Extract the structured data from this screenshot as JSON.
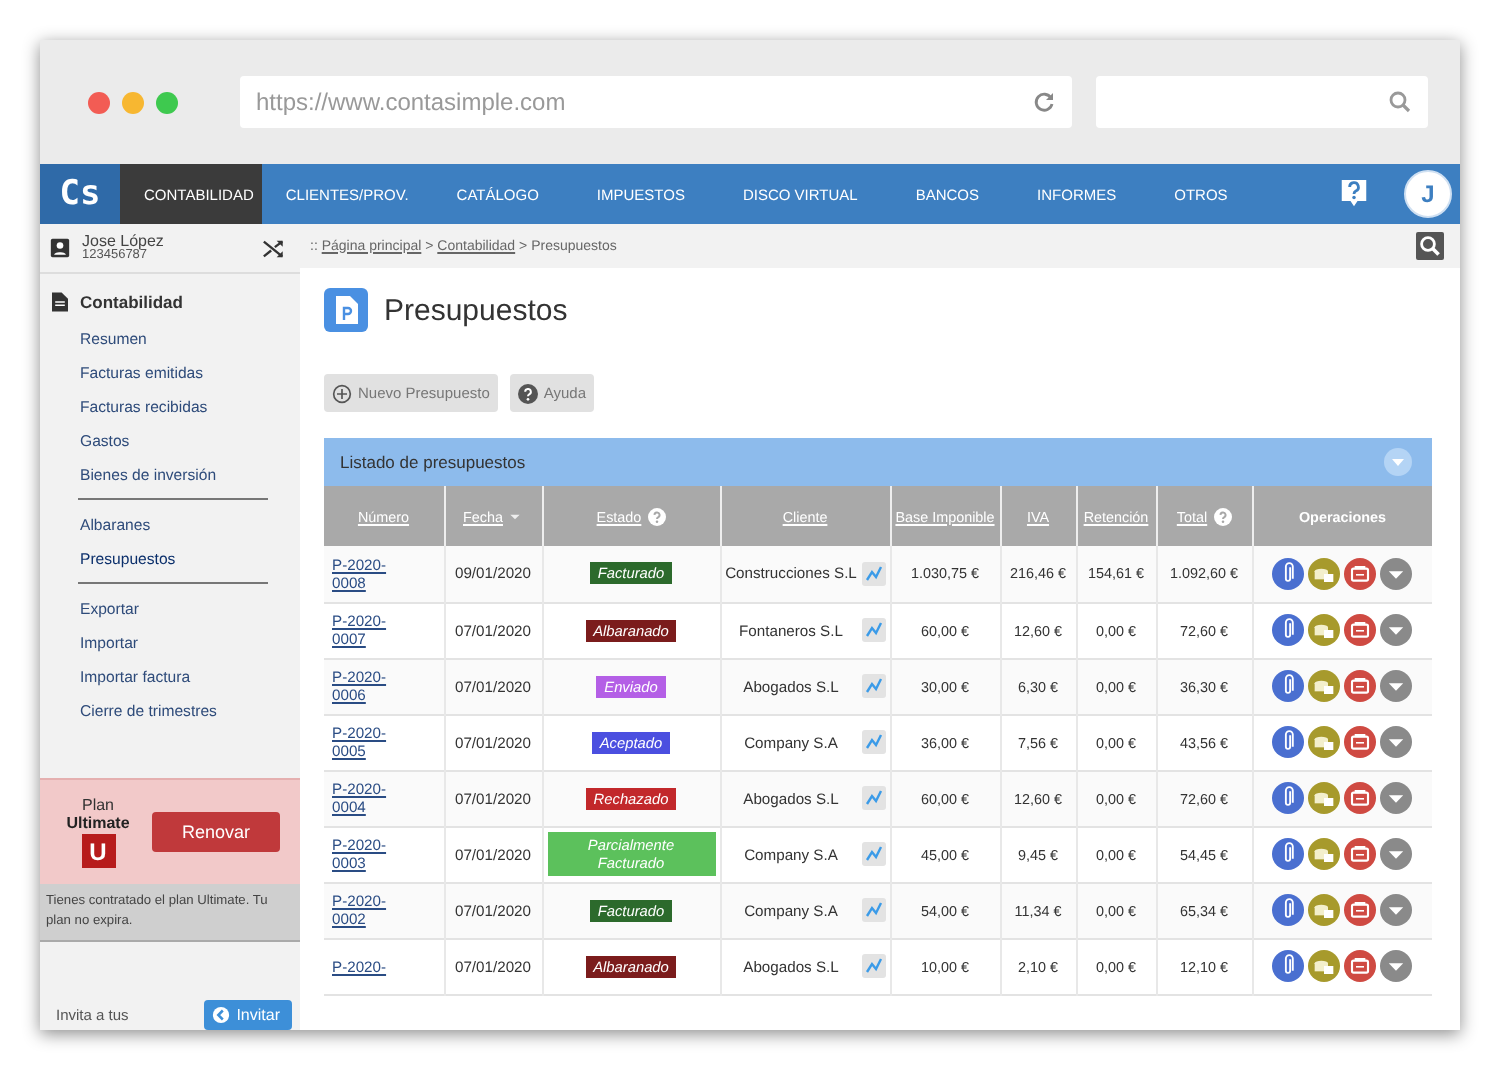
{
  "browser": {
    "url": "https://www.contasimple.com"
  },
  "nav": {
    "logo": "Cs",
    "tabs": [
      {
        "label": "CONTABILIDAD",
        "selected": true
      },
      {
        "label": "CLIENTES/PROV.",
        "selected": false
      },
      {
        "label": "CATÁLOGO",
        "selected": false
      },
      {
        "label": "IMPUESTOS",
        "selected": false
      },
      {
        "label": "DISCO VIRTUAL",
        "selected": false
      },
      {
        "label": "BANCOS",
        "selected": false
      },
      {
        "label": "INFORMES",
        "selected": false
      },
      {
        "label": "OTROS",
        "selected": false
      }
    ],
    "avatar": "J"
  },
  "user": {
    "name": "Jose López",
    "id": "123456787"
  },
  "breadcrumb": [
    {
      "kind": "text",
      "text": "::"
    },
    {
      "kind": "link",
      "text": "Página principal"
    },
    {
      "kind": "text",
      "text": ">"
    },
    {
      "kind": "link",
      "text": "Contabilidad"
    },
    {
      "kind": "text",
      "text": ">"
    },
    {
      "kind": "text",
      "text": "Presupuestos"
    }
  ],
  "sidebar": {
    "section": "Contabilidad",
    "groups": [
      [
        {
          "label": "Resumen",
          "selected": false
        },
        {
          "label": "Facturas emitidas",
          "selected": false
        },
        {
          "label": "Facturas recibidas",
          "selected": false
        },
        {
          "label": "Gastos",
          "selected": false
        },
        {
          "label": "Bienes de inversión",
          "selected": false
        }
      ],
      [
        {
          "label": "Albaranes",
          "selected": false
        },
        {
          "label": "Presupuestos",
          "selected": true
        }
      ],
      [
        {
          "label": "Exportar",
          "selected": false
        },
        {
          "label": "Importar",
          "selected": false
        },
        {
          "label": "Importar factura",
          "selected": false
        },
        {
          "label": "Cierre de trimestres",
          "selected": false
        }
      ]
    ]
  },
  "plan": {
    "label": "Plan",
    "name": "Ultimate",
    "badge": "U",
    "button": "Renovar",
    "note": "Tienes contratado el plan Ultimate. Tu plan no expira."
  },
  "invite": {
    "text": "Invita a tus",
    "button": "Invitar"
  },
  "page": {
    "title": "Presupuestos",
    "buttons": [
      {
        "label": "Nuevo Presupuesto",
        "kind": "add"
      },
      {
        "label": "Ayuda",
        "kind": "help"
      }
    ]
  },
  "table": {
    "title": "Listado de presupuestos",
    "columns": [
      {
        "label": "Número",
        "link": true
      },
      {
        "label": "Fecha",
        "link": true,
        "sorted": true
      },
      {
        "label": "Estado",
        "link": true,
        "help": true
      },
      {
        "label": "Cliente",
        "link": true
      },
      {
        "label": "Base Imponible",
        "link": true
      },
      {
        "label": "IVA",
        "link": true
      },
      {
        "label": "Retención",
        "link": true
      },
      {
        "label": "Total",
        "link": true,
        "help": true
      },
      {
        "label": "Operaciones",
        "link": false
      }
    ],
    "rows": [
      {
        "number": "P-2020-0008",
        "date": "09/01/2020",
        "status": {
          "label": "Facturado",
          "color": "#2c6a2c"
        },
        "client": "Construcciones S.L",
        "base": "1.030,75 €",
        "iva": "216,46 €",
        "retention": "154,61 €",
        "total": "1.092,60 €"
      },
      {
        "number": "P-2020-0007",
        "date": "07/01/2020",
        "status": {
          "label": "Albaranado",
          "color": "#7b1c1c"
        },
        "client": "Fontaneros S.L",
        "base": "60,00 €",
        "iva": "12,60 €",
        "retention": "0,00 €",
        "total": "72,60 €"
      },
      {
        "number": "P-2020-0006",
        "date": "07/01/2020",
        "status": {
          "label": "Enviado",
          "color": "#b45fe6"
        },
        "client": "Abogados S.L",
        "base": "30,00 €",
        "iva": "6,30 €",
        "retention": "0,00 €",
        "total": "36,30 €"
      },
      {
        "number": "P-2020-0005",
        "date": "07/01/2020",
        "status": {
          "label": "Aceptado",
          "color": "#4b4fe0"
        },
        "client": "Company S.A",
        "base": "36,00 €",
        "iva": "7,56 €",
        "retention": "0,00 €",
        "total": "43,56 €"
      },
      {
        "number": "P-2020-0004",
        "date": "07/01/2020",
        "status": {
          "label": "Rechazado",
          "color": "#c2282b"
        },
        "client": "Abogados S.L",
        "base": "60,00 €",
        "iva": "12,60 €",
        "retention": "0,00 €",
        "total": "72,60 €"
      },
      {
        "number": "P-2020-0003",
        "date": "07/01/2020",
        "status": {
          "label": "Parcialmente Facturado",
          "color": "#5cc15c"
        },
        "client": "Company S.A",
        "base": "45,00 €",
        "iva": "9,45 €",
        "retention": "0,00 €",
        "total": "54,45 €"
      },
      {
        "number": "P-2020-0002",
        "date": "07/01/2020",
        "status": {
          "label": "Facturado",
          "color": "#2c6a2c"
        },
        "client": "Company S.A",
        "base": "54,00 €",
        "iva": "11,34 €",
        "retention": "0,00 €",
        "total": "65,34 €"
      },
      {
        "number": "P-2020-",
        "date": "07/01/2020",
        "status": {
          "label": "Albaranado",
          "color": "#7b1c1c"
        },
        "client": "Abogados S.L",
        "base": "10,00 €",
        "iva": "2,10 €",
        "retention": "0,00 €",
        "total": "12,10 €"
      }
    ]
  }
}
